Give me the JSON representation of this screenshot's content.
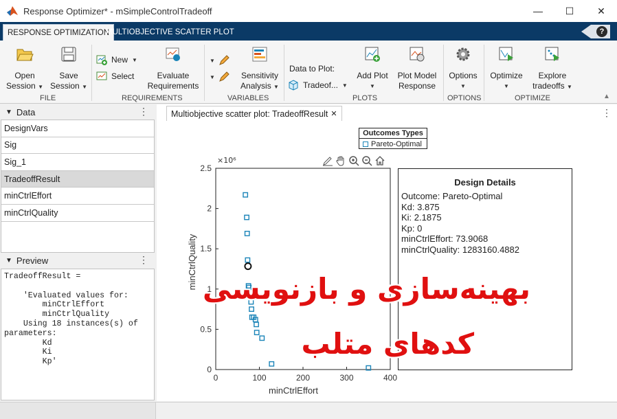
{
  "window": {
    "title": "Response Optimizer* - mSimpleControlTradeoff",
    "minimize": "—",
    "maximize": "☐",
    "close": "✕"
  },
  "tabs": [
    {
      "label": "RESPONSE OPTIMIZATION",
      "active": true
    },
    {
      "label": "MULTIOBJECTIVE SCATTER PLOT",
      "active": false
    }
  ],
  "help": "?",
  "ribbon": {
    "file": {
      "section": "FILE",
      "open": [
        "Open",
        "Session"
      ],
      "save": [
        "Save",
        "Session"
      ]
    },
    "requirements": {
      "section": "REQUIREMENTS",
      "new": "New",
      "select": "Select",
      "evaluate": [
        "Evaluate",
        "Requirements"
      ]
    },
    "variables": {
      "section": "VARIABLES",
      "sensitivity": [
        "Sensitivity",
        "Analysis"
      ]
    },
    "plots": {
      "section": "PLOTS",
      "data_to_plot_label": "Data to Plot:",
      "data_to_plot_value": "Tradeof...",
      "add_plot": [
        "Add Plot"
      ],
      "plot_model": [
        "Plot Model",
        "Response"
      ]
    },
    "options": {
      "section": "OPTIONS",
      "options": "Options"
    },
    "optimize": {
      "section": "OPTIMIZE",
      "optimize": "Optimize",
      "explore": [
        "Explore",
        "tradeoffs"
      ]
    }
  },
  "data_panel": {
    "title": "Data",
    "items": [
      "DesignVars",
      "Sig",
      "Sig_1",
      "TradeoffResult",
      "minCtrlEffort",
      "minCtrlQuality"
    ],
    "selected_index": 3
  },
  "preview_panel": {
    "title": "Preview",
    "text": "TradeoffResult =\n\n    'Evaluated values for:\n        minCtrlEffort\n        minCtrlQuality\n    Using 18 instances(s) of\nparameters:\n        Kd\n        Ki\n        Kp'"
  },
  "document_tab": {
    "label": "Multiobjective scatter plot: TradeoffResult",
    "close": "✕"
  },
  "legend": {
    "title": "Outcomes Types",
    "entry": "Pareto-Optimal"
  },
  "details": {
    "title": "Design Details",
    "lines": [
      "Outcome: Pareto-Optimal",
      "Kd: 3.875",
      "Ki: 2.1875",
      "Kp: 0",
      "minCtrlEffort: 73.9068",
      "minCtrlQuality: 1283160.4882"
    ]
  },
  "overlay_text": {
    "line1": "بهینه‌سازی و بازنویسی",
    "line2": "کدهای متلب"
  },
  "colors": {
    "marker": "#1a84b8",
    "overlay": "#e01010",
    "tabbar": "#0b3a66"
  },
  "chart_data": {
    "type": "scatter",
    "xlabel": "minCtrlEffort",
    "ylabel": "minCtrlQuality",
    "exponent_label": "×10⁶",
    "xlim": [
      0,
      400
    ],
    "ylim": [
      0,
      2.5
    ],
    "xticks": [
      0,
      100,
      200,
      300,
      400
    ],
    "yticks": [
      0,
      0.5,
      1,
      1.5,
      2,
      2.5
    ],
    "series": [
      {
        "name": "Pareto-Optimal",
        "points": [
          [
            68,
            2.17
          ],
          [
            71,
            1.89
          ],
          [
            72,
            1.69
          ],
          [
            73,
            1.36
          ],
          [
            75,
            1.04
          ],
          [
            76,
            1.02
          ],
          [
            81,
            0.84
          ],
          [
            82,
            0.75
          ],
          [
            83,
            0.65
          ],
          [
            87,
            0.65
          ],
          [
            91,
            0.62
          ],
          [
            93,
            0.56
          ],
          [
            94,
            0.46
          ],
          [
            106,
            0.39
          ],
          [
            128,
            0.07
          ],
          [
            350,
            0.02
          ]
        ]
      }
    ],
    "highlight": [
      73.9068,
      1.28316
    ]
  }
}
